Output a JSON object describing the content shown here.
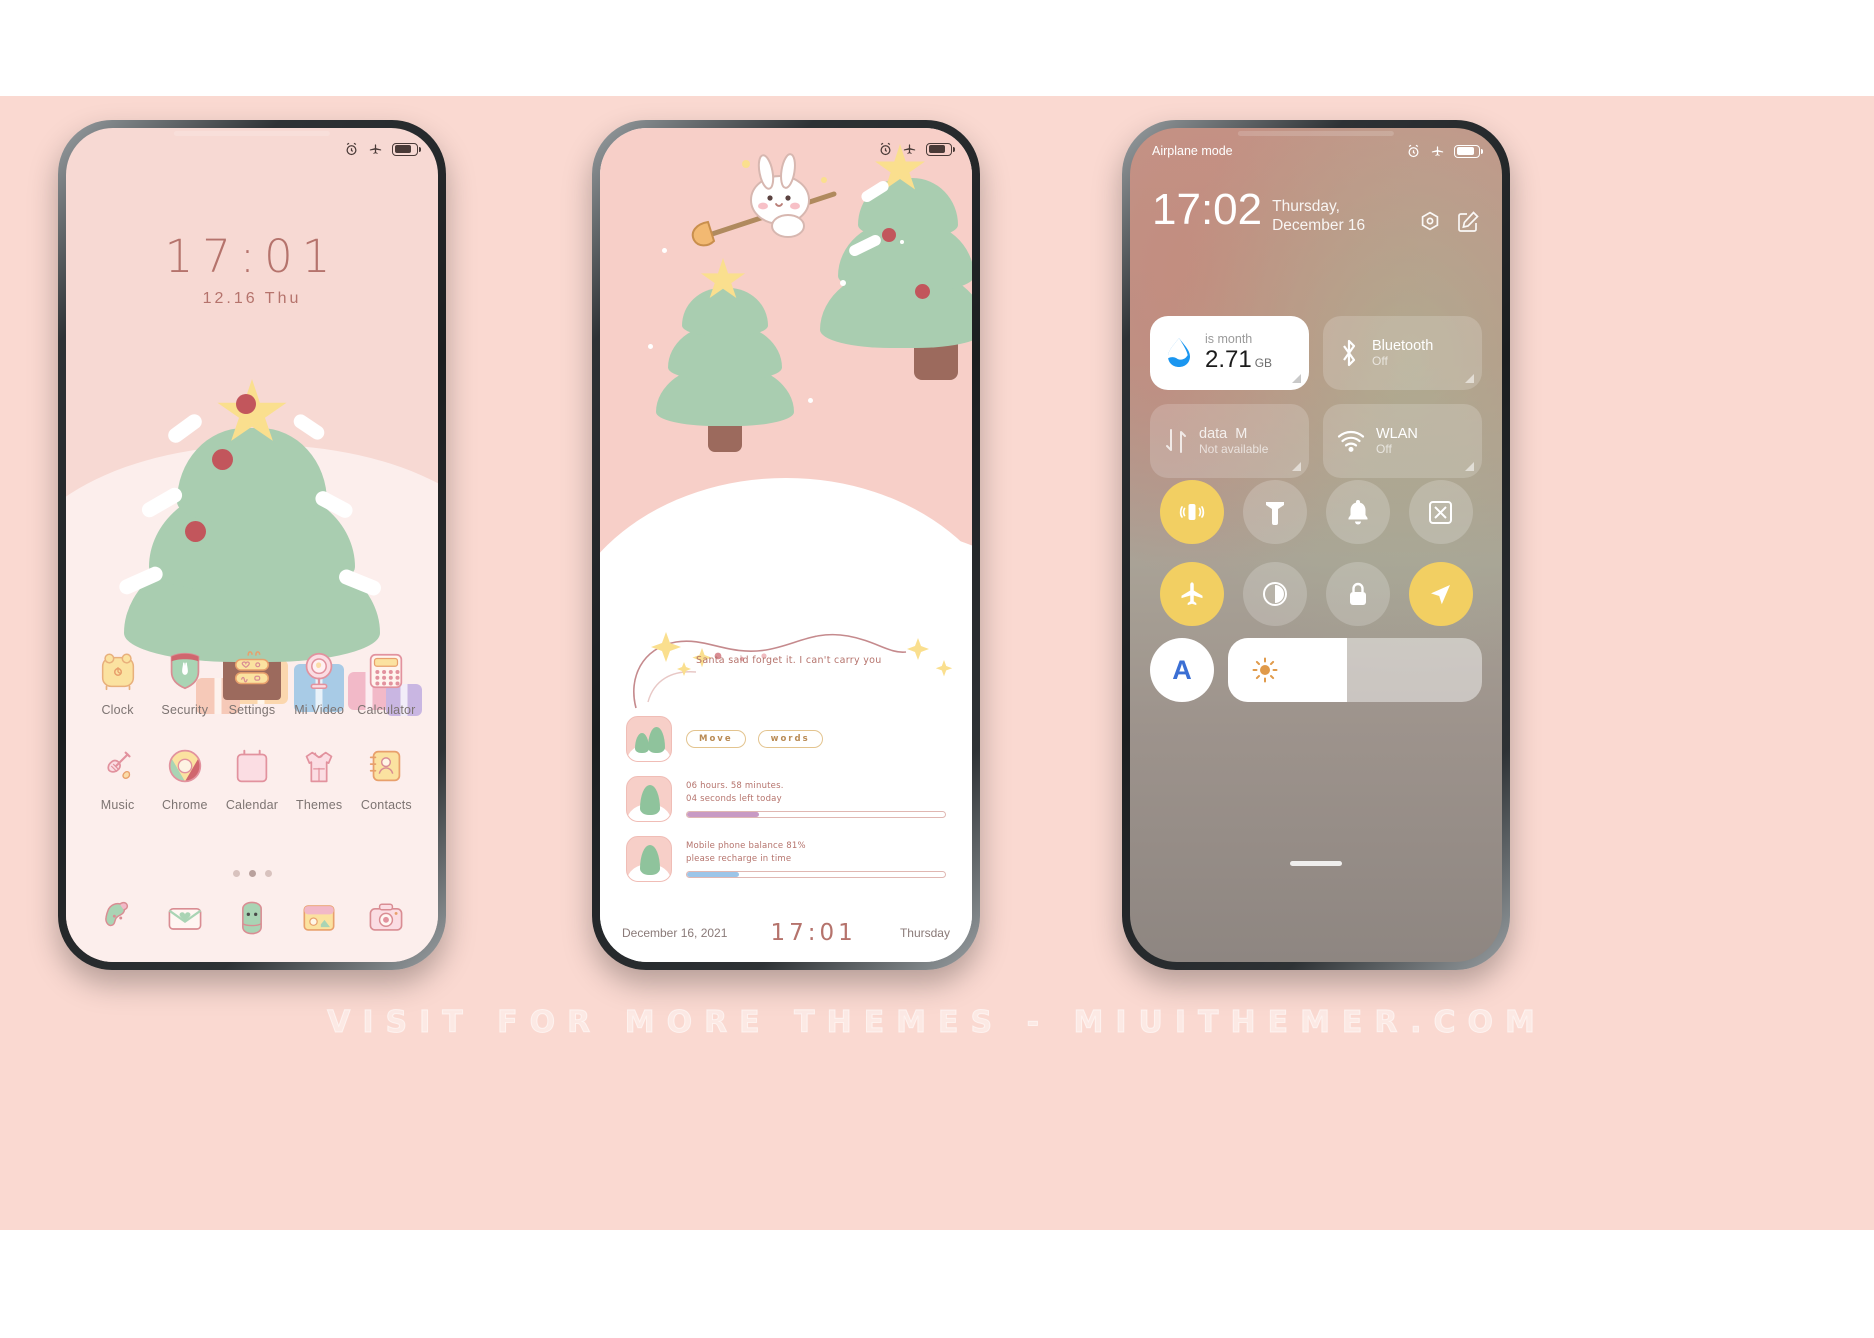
{
  "watermark": "VISIT FOR MORE THEMES - MIUITHEMER.COM",
  "colors": {
    "page_bg": "#fad9d1",
    "accent_pink": "#b5736c",
    "tree_green": "#a9cdb0",
    "star_yellow": "#fadf8e",
    "bauble_red": "#c2565c",
    "toggle_on": "#f2cf62",
    "bluetooth_blue": "#1a96f0"
  },
  "phone1": {
    "name": "Lock / Home screen",
    "status": {
      "alarm": "alarm-icon",
      "airplane": "airplane-icon",
      "battery": "battery-icon"
    },
    "clock": "17:01",
    "date": "12.16 Thu",
    "apps_row1": [
      {
        "label": "Clock",
        "icon": "clock-icon"
      },
      {
        "label": "Security",
        "icon": "security-shield-icon"
      },
      {
        "label": "Settings",
        "icon": "settings-icon"
      },
      {
        "label": "Mi Video",
        "icon": "mi-video-icon"
      },
      {
        "label": "Calculator",
        "icon": "calculator-icon"
      }
    ],
    "apps_row2": [
      {
        "label": "Music",
        "icon": "music-icon"
      },
      {
        "label": "Chrome",
        "icon": "chrome-icon"
      },
      {
        "label": "Calendar",
        "icon": "calendar-icon"
      },
      {
        "label": "Themes",
        "icon": "themes-icon"
      },
      {
        "label": "Contacts",
        "icon": "contacts-icon"
      }
    ],
    "dock": [
      {
        "icon": "phone-dialer-icon"
      },
      {
        "icon": "messaging-icon"
      },
      {
        "icon": "browser-icon"
      },
      {
        "icon": "gallery-icon"
      },
      {
        "icon": "camera-icon"
      }
    ],
    "page_dots": 3,
    "active_dot": 2
  },
  "phone2": {
    "name": "Second home screen with widgets",
    "status": {
      "alarm": "alarm-icon",
      "airplane": "airplane-icon",
      "battery": "battery-icon"
    },
    "quote": "Santa said forget it. I can't carry you",
    "widgets": [
      {
        "thumb": "tree-thumb-icon",
        "type": "pills",
        "pills": [
          "Move",
          "words"
        ]
      },
      {
        "thumb": "tree-thumb-icon",
        "type": "progress",
        "line1": "06 hours. 58 minutes.",
        "line2": "04 seconds left today",
        "progress": 28,
        "bar_color": "#c89ac4"
      },
      {
        "thumb": "tree-thumb-icon",
        "type": "progress",
        "line1": "Mobile phone balance 81%",
        "line2": "please recharge in time",
        "progress": 20,
        "bar_color": "#9cc5e8"
      }
    ],
    "bottom": {
      "date": "December 16, 2021",
      "time": "17:01",
      "weekday": "Thursday"
    }
  },
  "phone3": {
    "name": "Control center",
    "status_label": "Airplane mode",
    "status_icons": {
      "alarm": "alarm-icon",
      "airplane": "airplane-icon",
      "battery": "battery-icon"
    },
    "time": "17:02",
    "date": "Thursday, December 16",
    "header_actions": [
      {
        "icon": "settings-hex-icon"
      },
      {
        "icon": "edit-icon"
      }
    ],
    "cards": [
      {
        "id": "data-usage",
        "title": "is month",
        "value": "2.71",
        "unit": "GB",
        "icon": "data-drop-icon",
        "style": "white",
        "trailing": "l"
      },
      {
        "id": "bluetooth",
        "title": "Bluetooth",
        "subtitle": "Off",
        "icon": "bluetooth-icon",
        "style": "glass"
      },
      {
        "id": "mobile-data",
        "title": "data",
        "title_extra": "M",
        "subtitle": "Not available",
        "icon": "mobile-data-icon",
        "style": "glass"
      },
      {
        "id": "wlan",
        "title": "WLAN",
        "subtitle": "Off",
        "icon": "wifi-icon",
        "style": "glass"
      }
    ],
    "toggles": [
      {
        "id": "vibrate",
        "icon": "vibrate-icon",
        "on": true
      },
      {
        "id": "flashlight",
        "icon": "flashlight-icon",
        "on": false
      },
      {
        "id": "ringer",
        "icon": "bell-icon",
        "on": false
      },
      {
        "id": "screenshot",
        "icon": "screenshot-icon",
        "on": false
      },
      {
        "id": "airplane",
        "icon": "airplane-icon",
        "on": true
      },
      {
        "id": "dark-mode",
        "icon": "contrast-icon",
        "on": false
      },
      {
        "id": "lock",
        "icon": "lock-icon",
        "on": false
      },
      {
        "id": "location",
        "icon": "location-arrow-icon",
        "on": true
      }
    ],
    "brightness": {
      "auto_label": "A",
      "icon": "sun-icon",
      "value": 47
    }
  }
}
